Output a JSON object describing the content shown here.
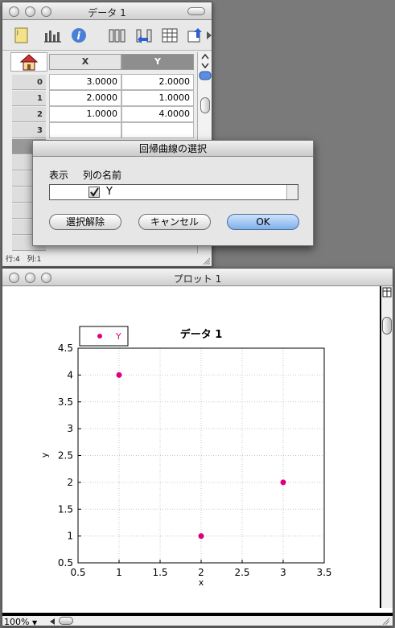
{
  "data_window": {
    "title": "データ 1",
    "columns": [
      "X",
      "Y"
    ],
    "row_numbers": [
      "0",
      "1",
      "2",
      "3"
    ],
    "rows": [
      [
        "3.0000",
        "2.0000"
      ],
      [
        "2.0000",
        "1.0000"
      ],
      [
        "1.0000",
        "4.0000"
      ]
    ],
    "status_rows": "行:4",
    "status_cols": "列:1"
  },
  "dialog": {
    "title": "回帰曲線の選択",
    "header_show": "表示",
    "header_column_name": "列の名前",
    "item_label": "Y",
    "item_checked": true,
    "btn_deselect": "選択解除",
    "btn_cancel": "キャンセル",
    "btn_ok": "OK"
  },
  "plot_window": {
    "title": "プロット 1",
    "zoom": "100%"
  },
  "chart_data": {
    "type": "scatter",
    "title": "データ 1",
    "xlabel": "x",
    "ylabel": "y",
    "legend": "Y",
    "legend_position": "top-left",
    "xlim": [
      0.5,
      3.5
    ],
    "ylim": [
      0.5,
      4.5
    ],
    "x_ticks": [
      "0.5",
      "1",
      "1.5",
      "2",
      "2.5",
      "3",
      "3.5"
    ],
    "y_ticks": [
      "0.5",
      "1",
      "1.5",
      "2",
      "2.5",
      "3",
      "3.5",
      "4",
      "4.5"
    ],
    "grid": true,
    "series": [
      {
        "name": "Y",
        "color": "#e0007f",
        "points": [
          [
            3,
            2
          ],
          [
            2,
            1
          ],
          [
            1,
            4
          ]
        ]
      }
    ]
  }
}
